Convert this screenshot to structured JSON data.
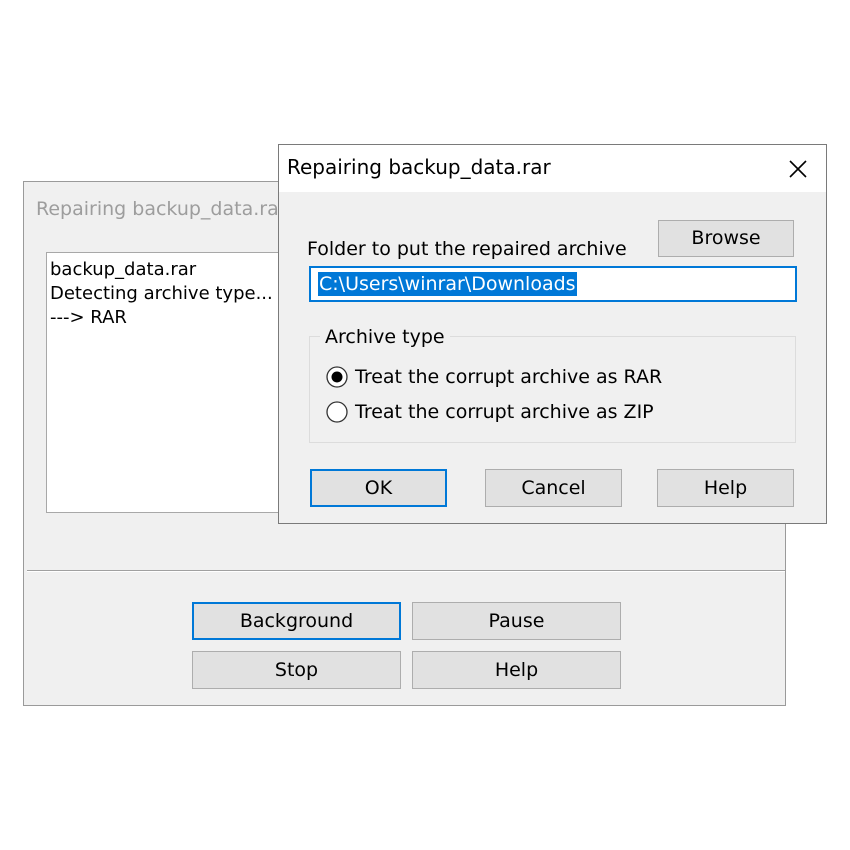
{
  "back_window": {
    "title": "Repairing backup_data.rar",
    "log_lines": [
      "backup_data.rar",
      "Detecting archive type...",
      "---> RAR"
    ],
    "buttons": {
      "background": "Background",
      "pause": "Pause",
      "stop": "Stop",
      "help": "Help"
    }
  },
  "dialog": {
    "title": "Repairing backup_data.rar",
    "folder_label": "Folder to put the repaired archive",
    "browse_label": "Browse",
    "folder_value": "C:\\Users\\winrar\\Downloads",
    "archive_type": {
      "legend": "Archive type",
      "options": [
        {
          "label": "Treat the corrupt archive as RAR",
          "selected": true
        },
        {
          "label": "Treat the corrupt archive as ZIP",
          "selected": false
        }
      ]
    },
    "buttons": {
      "ok": "OK",
      "cancel": "Cancel",
      "help": "Help"
    }
  },
  "colors": {
    "accent": "#0078d7",
    "window_bg": "#f0f0f0",
    "button_bg": "#e1e1e1"
  },
  "icons": {
    "close": "close-icon",
    "radio_checked": "radio-checked-icon",
    "radio_unchecked": "radio-unchecked-icon"
  }
}
